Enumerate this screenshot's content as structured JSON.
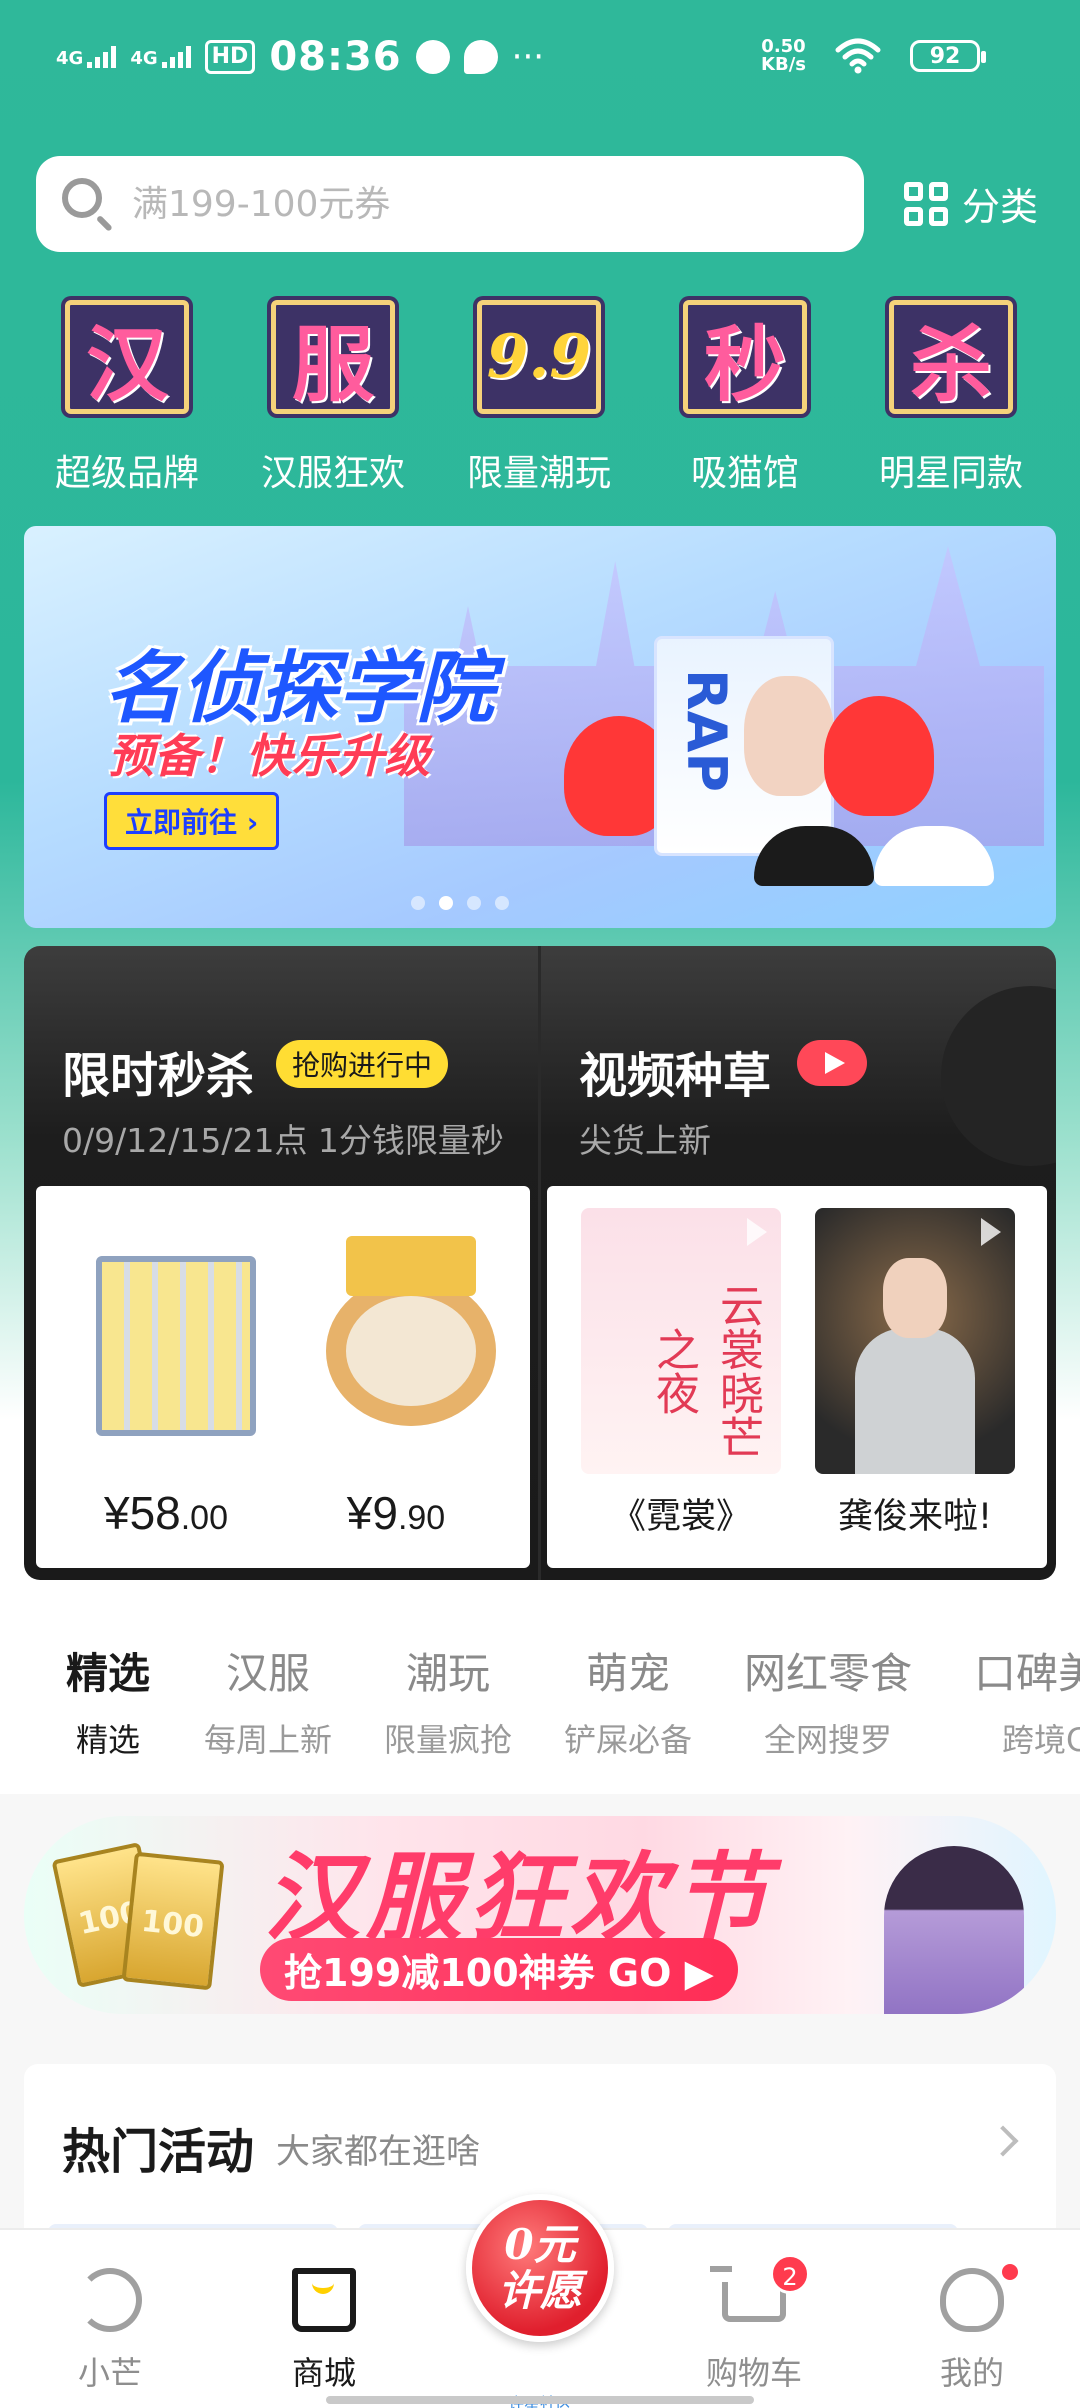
{
  "status_bar": {
    "time": "08:36",
    "sig1": "4G",
    "sig2": "4G",
    "hd": "HD",
    "net_speed_value": "0.50",
    "net_speed_unit": "KB/s",
    "battery": "92",
    "more": "···"
  },
  "search": {
    "placeholder": "满199-100元券"
  },
  "category_label": "分类",
  "quick_nav": [
    {
      "tile": "汉",
      "label": "超级品牌"
    },
    {
      "tile": "服",
      "label": "汉服狂欢"
    },
    {
      "tile": "9.9",
      "label": "限量潮玩"
    },
    {
      "tile": "秒",
      "label": "吸猫馆"
    },
    {
      "tile": "杀",
      "label": "明星同款"
    }
  ],
  "banner": {
    "title": "名侦探学院",
    "subtitle": "预备！快乐升级",
    "cta": "立即前往 ›",
    "product_text": "RAP",
    "slide_index": 2,
    "slide_count": 4
  },
  "flash_sale": {
    "title": "限时秒杀",
    "tag": "抢购进行中",
    "subtitle": "0/9/12/15/21点 1分钱限量秒",
    "products": [
      {
        "price_int": "¥58",
        "price_dec": ".00"
      },
      {
        "price_int": "¥9",
        "price_dec": ".90"
      }
    ]
  },
  "video": {
    "title": "视频种草",
    "subtitle": "尖货上新",
    "items": [
      {
        "thumb_text": "云裳晓芒之夜",
        "label": "《霓裳》"
      },
      {
        "label": "龚俊来啦!"
      }
    ]
  },
  "tabs": [
    {
      "title": "精选",
      "sub": "精选"
    },
    {
      "title": "汉服",
      "sub": "每周上新"
    },
    {
      "title": "潮玩",
      "sub": "限量疯抢"
    },
    {
      "title": "萌宠",
      "sub": "铲屎必备"
    },
    {
      "title": "网红零食",
      "sub": "全网搜罗"
    },
    {
      "title": "口碑美",
      "sub": "跨境C"
    }
  ],
  "hanfu_banner": {
    "coupon": "100",
    "title": "汉服狂欢节",
    "pill": "抢199减100神券 GO ▶"
  },
  "hot": {
    "title": "热门活动",
    "subtitle": "大家都在逛啥"
  },
  "bottom_nav": {
    "items": [
      "小芒",
      "商城",
      "购物车",
      "我的"
    ],
    "wish": "0元许愿",
    "wish_sub": "许星社区",
    "cart_count": "2"
  },
  "colors": {
    "brand_teal": "#2fb89a",
    "accent_yellow": "#ffdd33",
    "accent_red": "#ff3b4e"
  }
}
